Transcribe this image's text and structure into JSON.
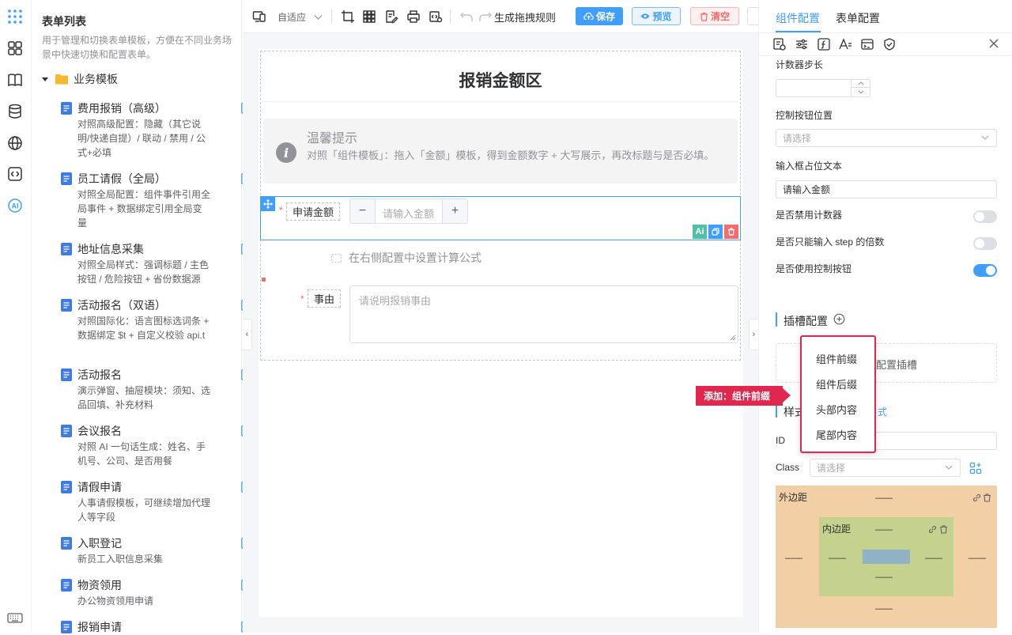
{
  "sidebar": {
    "title": "表单列表",
    "description": "用于管理和切换表单模板，方便在不同业务场景中快速切换和配置表单。",
    "folder": "业务模板",
    "items": [
      {
        "name": "费用报销（高级）",
        "desc": "对照高级配置：隐藏（其它说明/快递自提）/ 联动 / 禁用 / 公式+必填"
      },
      {
        "name": "员工请假（全局）",
        "desc": "对照全局配置：组件事件引用全局事件 + 数据绑定引用全局变量"
      },
      {
        "name": "地址信息采集",
        "desc": "对照全局样式：强调标题 / 主色按钮 / 危险按钮 + 省份数据源"
      },
      {
        "name": "活动报名（双语）",
        "desc": "对照国际化：语言图标选词条 + 数据绑定 $t + 自定义校验 api.t"
      },
      {
        "name": "活动报名",
        "desc": "演示弹窗、抽屉模块：须知、选品回填、补充材料"
      },
      {
        "name": "会议报名",
        "desc": "对照 AI 一句话生成：姓名、手机号、公司、是否用餐"
      },
      {
        "name": "请假申请",
        "desc": "人事请假模板，可继续增加代理人等字段"
      },
      {
        "name": "入职登记",
        "desc": "新员工入职信息采集"
      },
      {
        "name": "物资领用",
        "desc": "办公物资领用申请"
      },
      {
        "name": "报销申请",
        "desc": ""
      }
    ]
  },
  "toolbar": {
    "zoom_label": "自适应",
    "rules_label": "生成拖拽规则",
    "save_label": "保存",
    "preview_label": "预览",
    "clear_label": "清空"
  },
  "canvas": {
    "section_title": "报销金额区",
    "tip_title": "温馨提示",
    "tip_text": "对照「组件模板」：拖入「金额」模板，得到金额数字 + 大写展示，再改标题与是否必填。",
    "amount_label": "申请金额",
    "amount_placeholder": "请输入金额",
    "formula_hint": "在右侧配置中设置计算公式",
    "reason_label": "事由",
    "reason_placeholder": "请说明报销事由",
    "ai_badge": "Ai"
  },
  "panel": {
    "tab_component": "组件配置",
    "tab_form": "表单配置",
    "step_label": "计数器步长",
    "ctrl_pos_label": "控制按钮位置",
    "ctrl_pos_placeholder": "请选择",
    "placeholder_label": "输入框占位文本",
    "placeholder_value": "请输入金额",
    "disable_counter_label": "是否禁用计数器",
    "step_only_label": "是否只能输入 step 的倍数",
    "use_ctrl_label": "是否使用控制按钮",
    "slot_section": "插槽配置",
    "slot_placeholder": "配置插槽",
    "style_section_partial": "样式",
    "style_link_partial": "式",
    "id_label": "ID",
    "class_label": "Class",
    "class_placeholder": "请选择",
    "margin_label": "外边距",
    "padding_label": "内边距",
    "box_dash": "——"
  },
  "slot_menu": {
    "items": [
      "组件前缀",
      "组件后缀",
      "头部内容",
      "尾部内容"
    ]
  },
  "callout": {
    "text": "添加：组件前缀"
  },
  "colors": {
    "primary": "#409eff",
    "danger": "#e0284f",
    "margin_box": "#f2cfa4",
    "padding_box": "#c4d28e",
    "content_box": "#8fb2c6"
  }
}
